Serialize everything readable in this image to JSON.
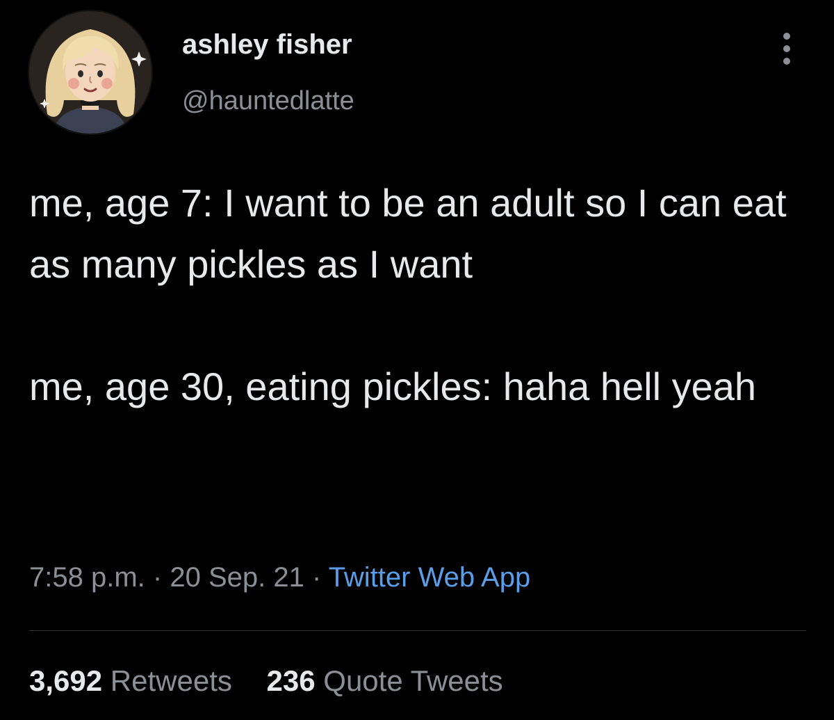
{
  "tweet": {
    "author": {
      "display_name": "ashley fisher",
      "handle": "@hauntedlatte",
      "avatar_icon": "illustrated-avatar"
    },
    "more_icon": "more-horizontal-icon",
    "text_paragraphs": [
      "me, age 7: I want to be an adult so I can eat as many pickles as I want",
      "me, age 30, eating pickles: haha hell yeah"
    ],
    "meta": {
      "time": "7:58 p.m.",
      "separator": "·",
      "date": "20 Sep. 21",
      "source": "Twitter Web App"
    },
    "stats": [
      {
        "count": "3,692",
        "label": "Retweets"
      },
      {
        "count": "236",
        "label": "Quote Tweets"
      }
    ]
  },
  "colors": {
    "background": "#000000",
    "primary_text": "#e7e9ea",
    "secondary_text": "#8b9096",
    "link": "#5b9ee8",
    "divider": "#2f3336"
  }
}
